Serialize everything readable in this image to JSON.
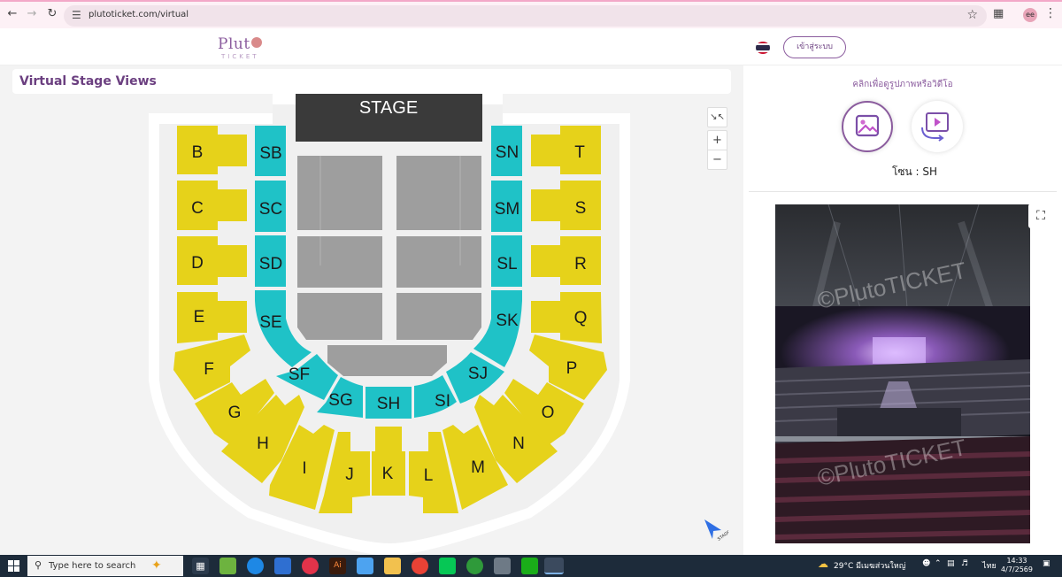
{
  "browser": {
    "url": "plutoticket.com/virtual",
    "profile_initials": "ee"
  },
  "header": {
    "logo_word": "Plut",
    "logo_sub": "TICKET",
    "login_label": "เข้าสู่ระบบ"
  },
  "page": {
    "title": "Virtual Stage Views"
  },
  "map": {
    "stage_label": "STAGE",
    "arrow_label": "STAGE",
    "yellow": "#e6d21a",
    "teal": "#1fc2c7",
    "gray_floor": "#9e9e9e",
    "stage_color": "#3a3a3a",
    "zones": [
      "B",
      "C",
      "D",
      "E",
      "F",
      "G",
      "H",
      "I",
      "J",
      "K",
      "L",
      "M",
      "N",
      "O",
      "P",
      "Q",
      "R",
      "S",
      "T",
      "SB",
      "SC",
      "SD",
      "SE",
      "SF",
      "SG",
      "SH",
      "SI",
      "SJ",
      "SK",
      "SL",
      "SM",
      "SN"
    ]
  },
  "right": {
    "hint": "คลิกเพื่อดูรูปภาพหรือวิดีโอ",
    "zone_label": "โซน : SH",
    "watermark": "©PlutoTICKET"
  },
  "taskbar": {
    "search_placeholder": "Type here to search",
    "weather": "29°C  มีเมฆส่วนใหญ่",
    "lang": "ไทย",
    "time": "14:33",
    "date": "4/7/2569"
  }
}
